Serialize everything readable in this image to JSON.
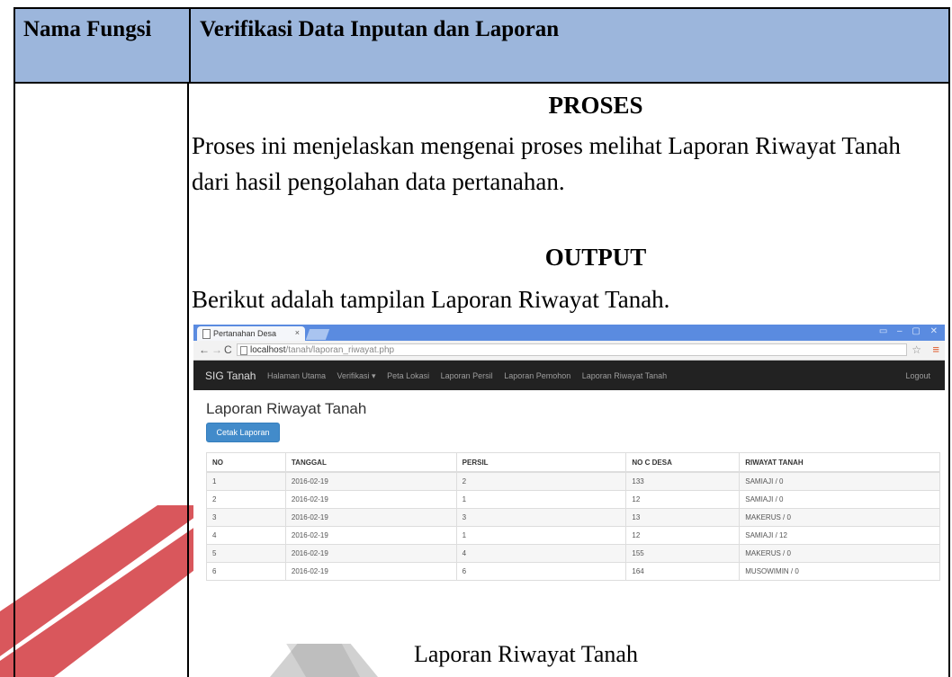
{
  "document": {
    "header_col1": "Nama Fungsi",
    "header_col2": "Verifikasi Data Inputan dan Laporan",
    "section_proses_title": "PROSES",
    "proses_text": "Proses ini menjelaskan mengenai proses melihat  Laporan Riwayat Tanah dari hasil pengolahan data pertanahan.",
    "section_output_title": "OUTPUT",
    "output_text": "Berikut adalah tampilan Laporan Riwayat Tanah.",
    "caption": "Laporan Riwayat Tanah"
  },
  "browser": {
    "tab_title": "Pertanahan Desa",
    "tab_close": "×",
    "url_host": "localhost",
    "url_path": "/tanah/laporan_riwayat.php"
  },
  "app": {
    "brand": "SIG Tanah",
    "nav_items": [
      "Halaman Utama",
      "Verifikasi ▾",
      "Peta Lokasi",
      "Laporan Persil",
      "Laporan Pemohon",
      "Laporan Riwayat Tanah"
    ],
    "logout": "Logout",
    "page_title": "Laporan Riwayat Tanah",
    "print_button": "Cetak Laporan",
    "table_headers": [
      "NO",
      "TANGGAL",
      "PERSIL",
      "NO C DESA",
      "RIWAYAT TANAH"
    ],
    "rows": [
      [
        "1",
        "2016-02-19",
        "2",
        "133",
        "SAMIAJI / 0"
      ],
      [
        "2",
        "2016-02-19",
        "1",
        "12",
        "SAMIAJI / 0"
      ],
      [
        "3",
        "2016-02-19",
        "3",
        "13",
        "MAKERUS / 0"
      ],
      [
        "4",
        "2016-02-19",
        "1",
        "12",
        "SAMIAJI / 12"
      ],
      [
        "5",
        "2016-02-19",
        "4",
        "155",
        "MAKERUS / 0"
      ],
      [
        "6",
        "2016-02-19",
        "6",
        "164",
        "MUSOWIMIN / 0"
      ]
    ]
  },
  "colors": {
    "header_bg": "#9cb6dc",
    "watermark_red": "#d23a3f",
    "watermark_gray": "#9a9a9a",
    "navbar_bg": "#222222",
    "button_blue": "#428bca"
  }
}
